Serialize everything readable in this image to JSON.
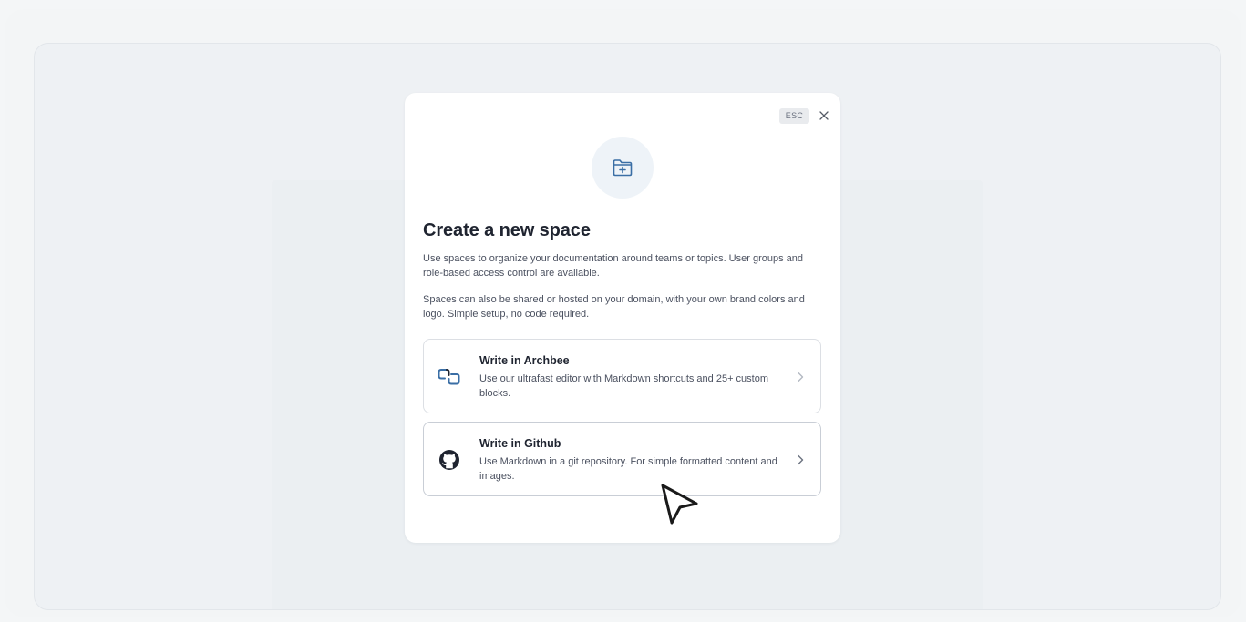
{
  "modal": {
    "esc_label": "ESC",
    "title": "Create a new space",
    "paragraph_1": "Use spaces to organize your documentation around teams or topics. User groups and role-based access control are available.",
    "paragraph_2": "Spaces can also be shared or hosted on your domain, with your own brand colors and logo. Simple setup, no code required.",
    "hero_icon": "folder-plus-icon",
    "close_icon": "close-icon",
    "options": [
      {
        "icon": "archbee-logo-icon",
        "title": "Write in Archbee",
        "description": "Use our ultrafast editor with Markdown shortcuts and 25+ custom blocks."
      },
      {
        "icon": "github-icon",
        "title": "Write in Github",
        "description": "Use Markdown in a git repository. For simple formatted content and images."
      }
    ]
  },
  "colors": {
    "accent": "#3a6ea5",
    "text_primary": "#1f2430",
    "text_secondary": "#4b5160"
  }
}
